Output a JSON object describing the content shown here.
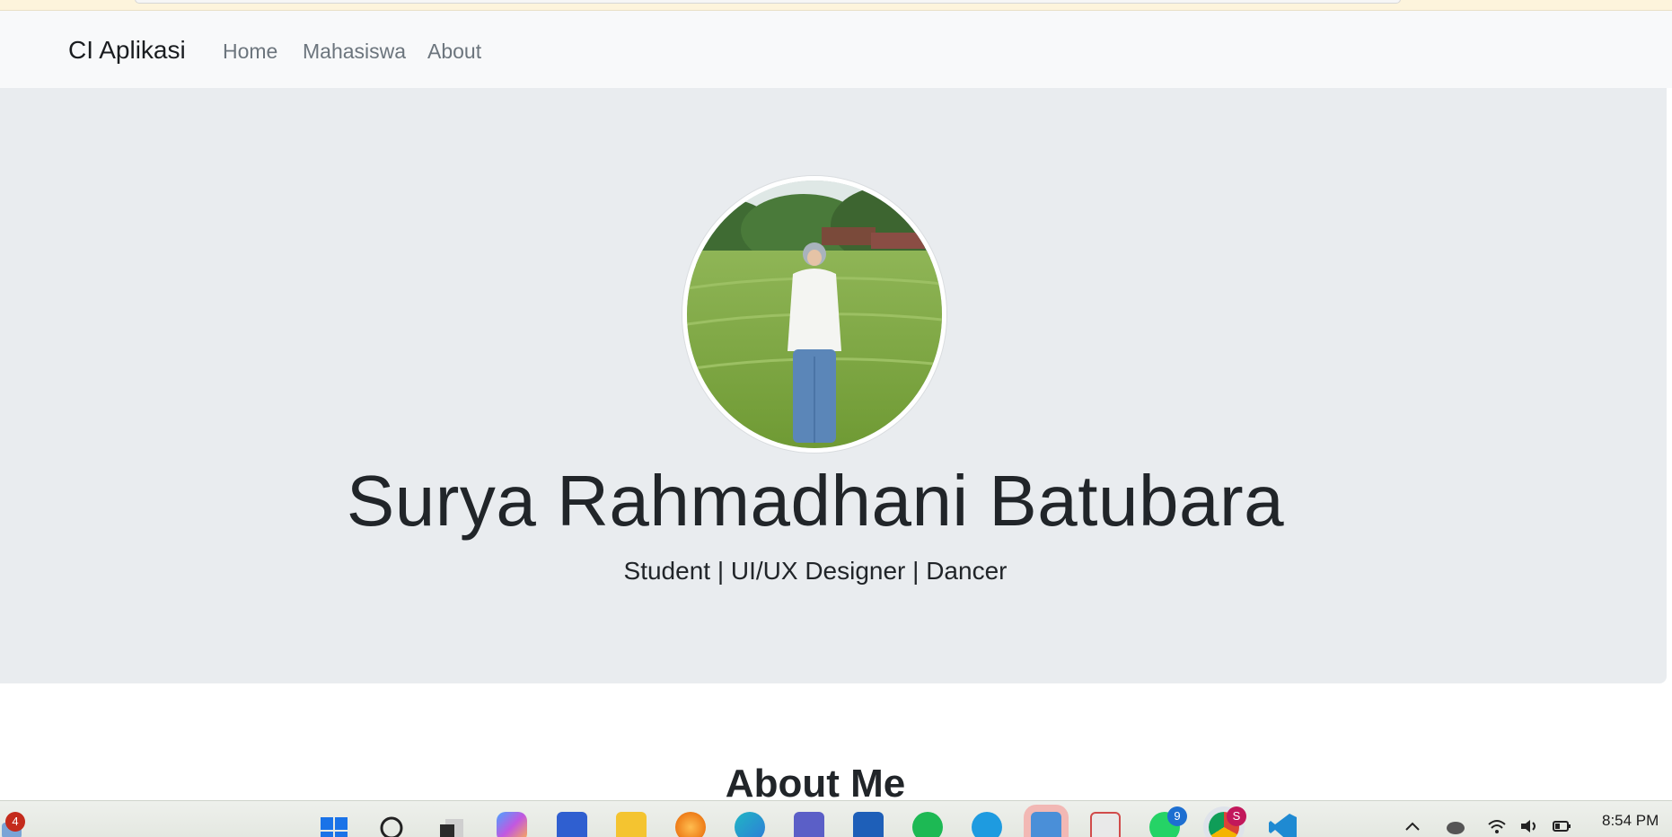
{
  "navbar": {
    "brand": "CI Aplikasi",
    "links": [
      "Home",
      "Mahasiswa",
      "About"
    ]
  },
  "hero": {
    "name": "Surya Rahmadhani Batubara",
    "subtitle": "Student | UI/UX Designer | Dancer"
  },
  "section": {
    "about_title": "About Me"
  },
  "taskbar": {
    "left_badge": "4",
    "whatsapp_badge": "9",
    "chrome_badge": "S",
    "clock": "8:54 PM",
    "icons": [
      "widgets-icon",
      "windows-start-icon",
      "search-icon",
      "task-view-icon",
      "copilot-icon",
      "visual-studio-icon",
      "file-explorer-icon",
      "firefox-icon",
      "edge-icon",
      "teams-icon",
      "microsoft-store-icon",
      "spotify-icon",
      "cloud-app-icon",
      "photos-icon",
      "snipping-tool-icon",
      "whatsapp-icon",
      "chrome-icon",
      "vscode-icon"
    ]
  },
  "colors": {
    "navbar_bg": "#f8f9fa",
    "hero_bg": "#e9ecef",
    "nav_link": "#6c757d",
    "text": "#212529"
  }
}
